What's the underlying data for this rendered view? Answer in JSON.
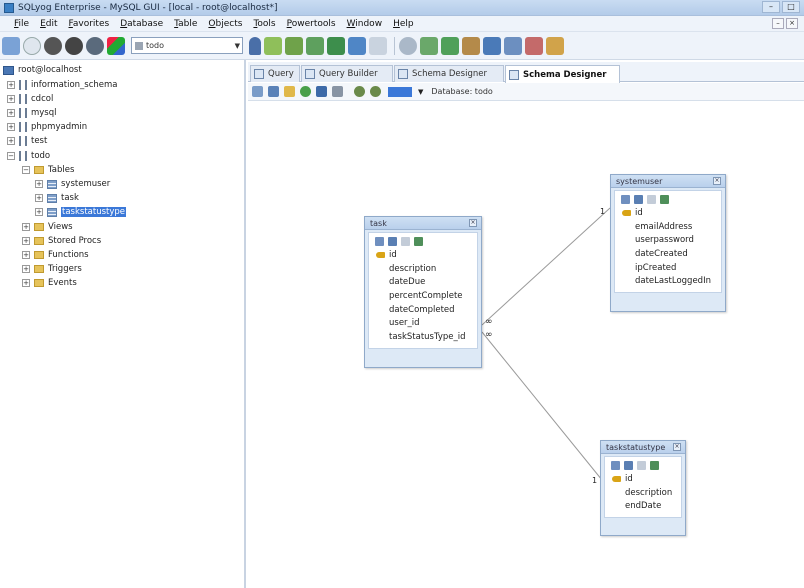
{
  "window": {
    "title": "SQLyog Enterprise - MySQL GUI - [local - root@localhost*]"
  },
  "menu": [
    "File",
    "Edit",
    "Favorites",
    "Database",
    "Table",
    "Objects",
    "Tools",
    "Powertools",
    "Window",
    "Help"
  ],
  "toolbar": {
    "db_select_value": "todo"
  },
  "tree": {
    "root": "root@localhost",
    "databases": [
      "information_schema",
      "cdcol",
      "mysql",
      "phpmyadmin",
      "test",
      "todo"
    ],
    "tables_label": "Tables",
    "tables": [
      "systemuser",
      "task",
      "taskstatustype"
    ],
    "folders": [
      "Views",
      "Stored Procs",
      "Functions",
      "Triggers",
      "Events"
    ]
  },
  "tabs": [
    "Query",
    "Query Builder",
    "Schema Designer",
    "Schema Designer"
  ],
  "designer": {
    "database_label": "Database: todo"
  },
  "entities": {
    "task": {
      "name": "task",
      "fields": [
        "id",
        "description",
        "dateDue",
        "percentComplete",
        "dateCompleted",
        "user_id",
        "taskStatusType_id"
      ]
    },
    "systemuser": {
      "name": "systemuser",
      "fields": [
        "id",
        "emailAddress",
        "userpassword",
        "dateCreated",
        "ipCreated",
        "dateLastLoggedIn"
      ]
    },
    "taskstatustype": {
      "name": "taskstatustype",
      "fields": [
        "id",
        "description",
        "endDate"
      ]
    }
  },
  "relations": {
    "one": "1",
    "many": "∞"
  }
}
